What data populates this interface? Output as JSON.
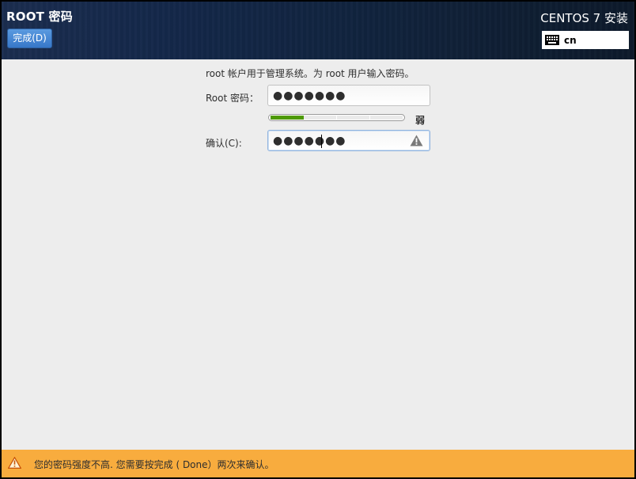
{
  "header": {
    "title": "ROOT 密码",
    "done_button": "完成(D)",
    "product": "CENTOS 7 安装",
    "keyboard_layout": "cn",
    "keyboard_icon": "keyboard-icon"
  },
  "form": {
    "intro": "root 帐户用于管理系统。为 root 用户输入密码。",
    "password_label": "Root 密码：",
    "password_value": "●●●●●●●",
    "confirm_label": "确认(C):",
    "confirm_value": "●●●●●●●",
    "confirm_icon": "warning-icon",
    "strength_fraction": 0.25,
    "strength_label": "弱",
    "strength_color": "#4e9a06"
  },
  "warning_bar": {
    "icon": "warning-icon",
    "text": "您的密码强度不高. 您需要按完成 ( Done）两次来确认。",
    "color": "#f8ac3e"
  }
}
